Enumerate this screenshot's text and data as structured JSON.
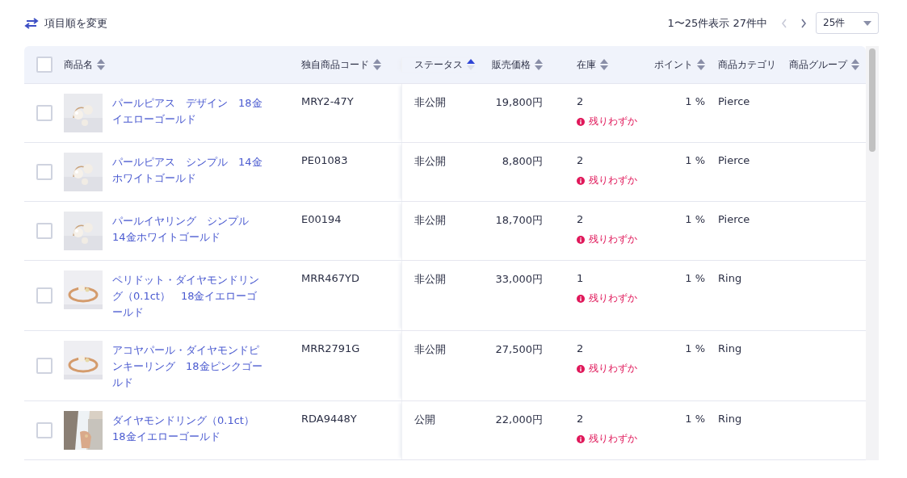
{
  "toolbar": {
    "reorder_label": "項目順を変更",
    "range_text": "1〜25件表示 27件中",
    "prev_disabled": true,
    "next_disabled": false,
    "per_page": "25件"
  },
  "table": {
    "select_all_checked": false,
    "columns": [
      {
        "label": "商品名",
        "sorted": false
      },
      {
        "label": "独自商品コード",
        "sorted": false
      },
      {
        "label": "ステータス",
        "sorted": true
      },
      {
        "label": "販売価格",
        "sorted": false
      },
      {
        "label": "在庫",
        "sorted": false
      },
      {
        "label": "ポイント",
        "sorted": false
      },
      {
        "label": "商品カテゴリ"
      },
      {
        "label": "商品グループ",
        "sorted": false
      }
    ],
    "rows": [
      {
        "checked": false,
        "name": "パールピアス　デザイン　18金イエローゴールド",
        "code": "MRY2-47Y",
        "status": "非公開",
        "price": "19,800円",
        "stock": "2",
        "low_stock": "残りわずか",
        "point": "1 %",
        "category": "Pierce"
      },
      {
        "checked": false,
        "name": "パールピアス　シンプル　14金ホワイトゴールド",
        "code": "PE01083",
        "status": "非公開",
        "price": "8,800円",
        "stock": "2",
        "low_stock": "残りわずか",
        "point": "1 %",
        "category": "Pierce"
      },
      {
        "checked": false,
        "name": "パールイヤリング　シンプル　14金ホワイトゴールド",
        "code": "E00194",
        "status": "非公開",
        "price": "18,700円",
        "stock": "2",
        "low_stock": "残りわずか",
        "point": "1 %",
        "category": "Pierce"
      },
      {
        "checked": false,
        "name": "ペリドット・ダイヤモンドリング（0.1ct）　18金イエローゴールド",
        "code": "MRR467YD",
        "status": "非公開",
        "price": "33,000円",
        "stock": "1",
        "low_stock": "残りわずか",
        "point": "1 %",
        "category": "Ring"
      },
      {
        "checked": false,
        "name": "アコヤパール・ダイヤモンドピンキーリング　18金ピンクゴールド",
        "code": "MRR2791G",
        "status": "非公開",
        "price": "27,500円",
        "stock": "2",
        "low_stock": "残りわずか",
        "point": "1 %",
        "category": "Ring"
      },
      {
        "checked": false,
        "name": "ダイヤモンドリング（0.1ct）　18金イエローゴールド",
        "code": "RDA9448Y",
        "status": "公開",
        "price": "22,000円",
        "stock": "2",
        "low_stock": "残りわずか",
        "point": "1 %",
        "category": "Ring"
      }
    ]
  }
}
